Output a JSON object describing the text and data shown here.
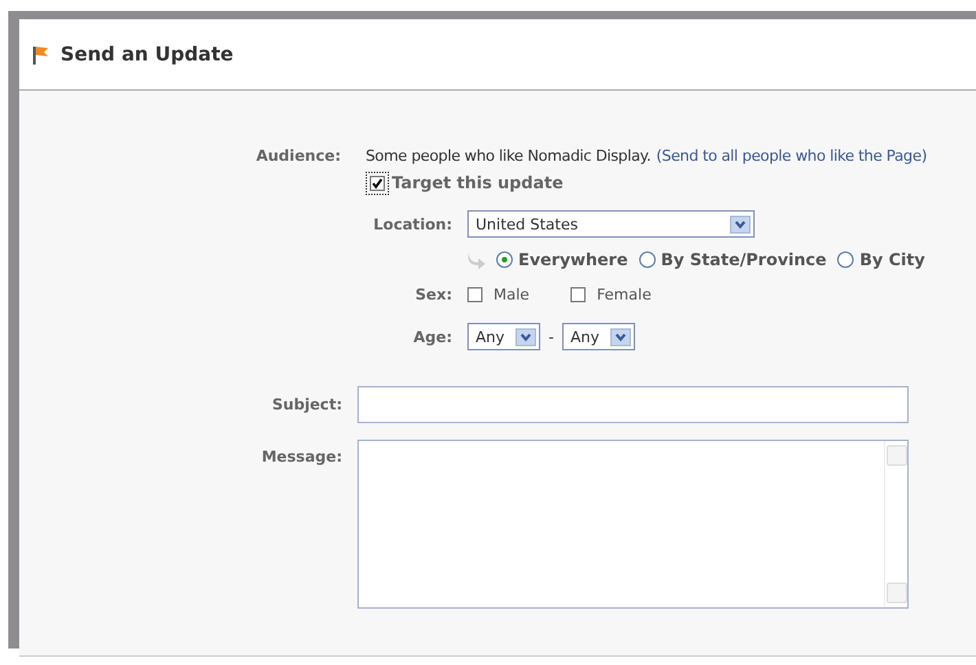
{
  "header": {
    "title": "Send an Update"
  },
  "audience": {
    "label": "Audience:",
    "text": "Some people who like Nomadic Display.",
    "link": "(Send to all people who like the Page)"
  },
  "target": {
    "label": "Target this update",
    "checked": true
  },
  "location": {
    "label": "Location:",
    "value": "United States"
  },
  "scope": [
    {
      "label": "Everywhere",
      "selected": true
    },
    {
      "label": "By State/Province",
      "selected": false
    },
    {
      "label": "By City",
      "selected": false
    }
  ],
  "sex": {
    "label": "Sex:",
    "options": [
      {
        "label": "Male",
        "checked": false
      },
      {
        "label": "Female",
        "checked": false
      }
    ]
  },
  "age": {
    "label": "Age:",
    "from": "Any",
    "separator": "-",
    "to": "Any"
  },
  "subject": {
    "label": "Subject:"
  },
  "message": {
    "label": "Message:"
  }
}
